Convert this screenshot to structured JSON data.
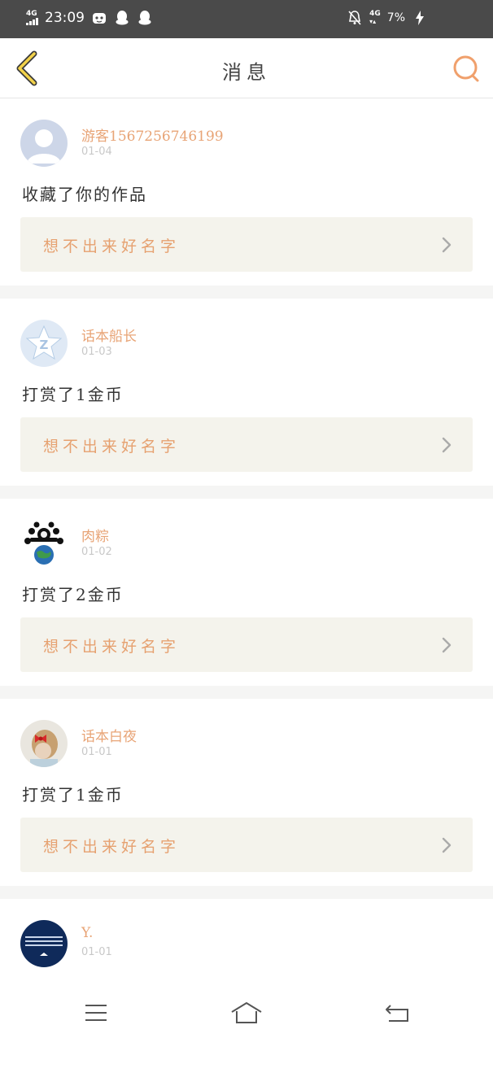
{
  "status_bar": {
    "network_left": "4G",
    "time": "23:09",
    "network_right": "4G",
    "battery": "7%"
  },
  "header": {
    "title": "消息"
  },
  "messages": [
    {
      "username": "游客15672567461​99",
      "date": "01-04",
      "action": "收藏了你的作品",
      "work_title": "想不出来好名字",
      "avatar": "default-person"
    },
    {
      "username": "话本船长",
      "date": "01-03",
      "action": "打赏了1金币",
      "work_title": "想不出来好名字",
      "avatar": "qzone-star"
    },
    {
      "username": "肉粽",
      "date": "01-02",
      "action": "打赏了2金币",
      "work_title": "想不出来好名字",
      "avatar": "earth-bears"
    },
    {
      "username": "话本白夜",
      "date": "01-01",
      "action": "打赏了1金币",
      "work_title": "想不出来好名字",
      "avatar": "girl-red-bow"
    },
    {
      "username": "Y.",
      "date": "01-01",
      "avatar": "dark-blue-stripes"
    }
  ],
  "colors": {
    "accent": "#e8a476",
    "work_bg": "#f4f3ec",
    "separator": "#f5f5f4",
    "status_bar": "#4a4a4a"
  }
}
